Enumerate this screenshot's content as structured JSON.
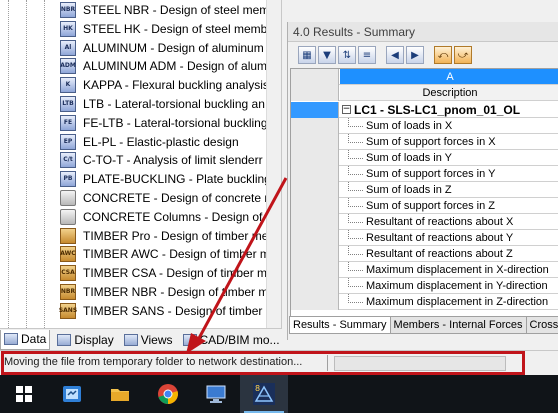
{
  "navigator": {
    "items": [
      {
        "icon": "steel-nbr-icon",
        "code": "NBR",
        "label": "STEEL NBR - Design of steel memb"
      },
      {
        "icon": "steel-hk-icon",
        "code": "HK",
        "label": "STEEL HK - Design of steel membe"
      },
      {
        "icon": "aluminum-icon",
        "code": "Al",
        "label": "ALUMINUM - Design of aluminum"
      },
      {
        "icon": "aluminum-adm-icon",
        "code": "ADM",
        "label": "ALUMINUM ADM - Design of aluminum"
      },
      {
        "icon": "kappa-icon",
        "code": "K",
        "label": "KAPPA - Flexural buckling analysis"
      },
      {
        "icon": "ltb-icon",
        "code": "LTB",
        "label": "LTB - Lateral-torsional buckling an"
      },
      {
        "icon": "fe-ltb-icon",
        "code": "FE",
        "label": "FE-LTB - Lateral-torsional buckling"
      },
      {
        "icon": "el-pl-icon",
        "code": "EP",
        "label": "EL-PL - Elastic-plastic design"
      },
      {
        "icon": "c-to-t-icon",
        "code": "C/t",
        "label": "C-TO-T - Analysis of limit slenderr"
      },
      {
        "icon": "plate-buckling-icon",
        "code": "PB",
        "label": "PLATE-BUCKLING - Plate buckling"
      },
      {
        "icon": "concrete-icon",
        "code": "",
        "label": "CONCRETE - Design of concrete m"
      },
      {
        "icon": "concrete-columns-icon",
        "code": "",
        "label": "CONCRETE Columns - Design of c"
      },
      {
        "icon": "timber-pro-icon",
        "code": "",
        "label": "TIMBER Pro - Design of timber me"
      },
      {
        "icon": "timber-awc-icon",
        "code": "AWC",
        "label": "TIMBER AWC - Design of timber m"
      },
      {
        "icon": "timber-csa-icon",
        "code": "CSA",
        "label": "TIMBER CSA - Design of timber m"
      },
      {
        "icon": "timber-nbr-icon",
        "code": "NBR",
        "label": "TIMBER NBR - Design of timber m"
      },
      {
        "icon": "timber-sans-icon",
        "code": "SANS",
        "label": "TIMBER SANS - Design of timber m"
      }
    ],
    "tabs": [
      {
        "label": "Data",
        "icon": "data-tab-icon"
      },
      {
        "label": "Display",
        "icon": "display-tab-icon"
      },
      {
        "label": "Views",
        "icon": "views-tab-icon"
      },
      {
        "label": "CAD/BIM mo...",
        "icon": "cad-bim-tab-icon"
      }
    ]
  },
  "results": {
    "title": "4.0 Results - Summary",
    "column_letter": "A",
    "column_header": "Description",
    "group_label": "LC1 - SLS-LC1_pnom_01_OL",
    "group_toggle": "−",
    "rows": [
      "Sum of loads in X",
      "Sum of support forces in X",
      "Sum of loads in Y",
      "Sum of support forces in Y",
      "Sum of loads in Z",
      "Sum of support forces in Z",
      "Resultant of reactions about X",
      "Resultant of reactions about Y",
      "Resultant of reactions about Z",
      "Maximum displacement in X-direction",
      "Maximum displacement in Y-direction",
      "Maximum displacement in Z-direction"
    ],
    "tabs": [
      "Results - Summary",
      "Members - Internal Forces",
      "Cross-S"
    ]
  },
  "status": {
    "message": "Moving the file from temporary folder to network destination...",
    "progress_fraction": 0.0
  },
  "taskbar": {
    "items": [
      "start-icon",
      "file-explorer-icon",
      "explorer-folder-icon",
      "chrome-icon",
      "remote-desktop-icon",
      "rfem-icon"
    ],
    "rfem_version": "8"
  },
  "colors": {
    "highlight": "#c0141a",
    "selection": "#3399ff",
    "column_header": "#1e90ff",
    "taskbar": "#101418"
  }
}
